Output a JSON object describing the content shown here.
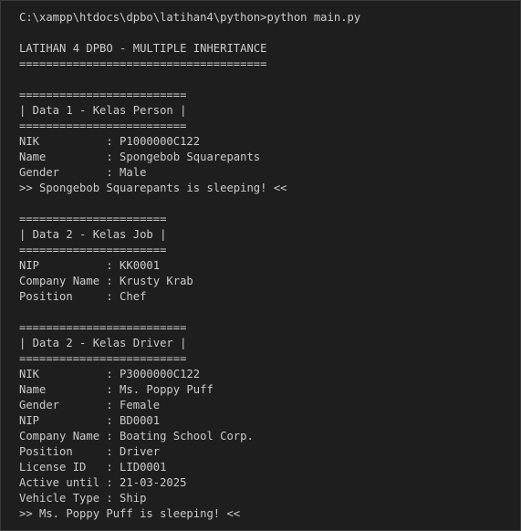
{
  "terminal": {
    "prompt": "C:\\xampp\\htdocs\\dpbo\\latihan4\\python>python main.py",
    "title": "LATIHAN 4 DPBO - MULTIPLE INHERITANCE",
    "title_rule": "=====================================",
    "person": {
      "rule": "=========================",
      "header": "| Data 1 - Kelas Person |",
      "fields": [
        "NIK          : P1000000C122",
        "Name         : Spongebob Squarepants",
        "Gender       : Male"
      ],
      "message": ">> Spongebob Squarepants is sleeping! <<"
    },
    "job": {
      "rule": "======================",
      "header": "| Data 2 - Kelas Job |",
      "fields": [
        "NIP          : KK0001",
        "Company Name : Krusty Krab",
        "Position     : Chef"
      ]
    },
    "driver": {
      "rule": "=========================",
      "header": "| Data 2 - Kelas Driver |",
      "fields": [
        "NIK          : P3000000C122",
        "Name         : Ms. Poppy Puff",
        "Gender       : Female",
        "NIP          : BD0001",
        "Company Name : Boating School Corp.",
        "Position     : Driver",
        "License ID   : LID0001",
        "Active until : 21-03-2025",
        "Vehicle Type : Ship"
      ],
      "message": ">> Ms. Poppy Puff is sleeping! <<"
    }
  },
  "colors": {
    "background": "#1e1e1e",
    "text": "#cccccc",
    "border": "#3c3c3c"
  }
}
